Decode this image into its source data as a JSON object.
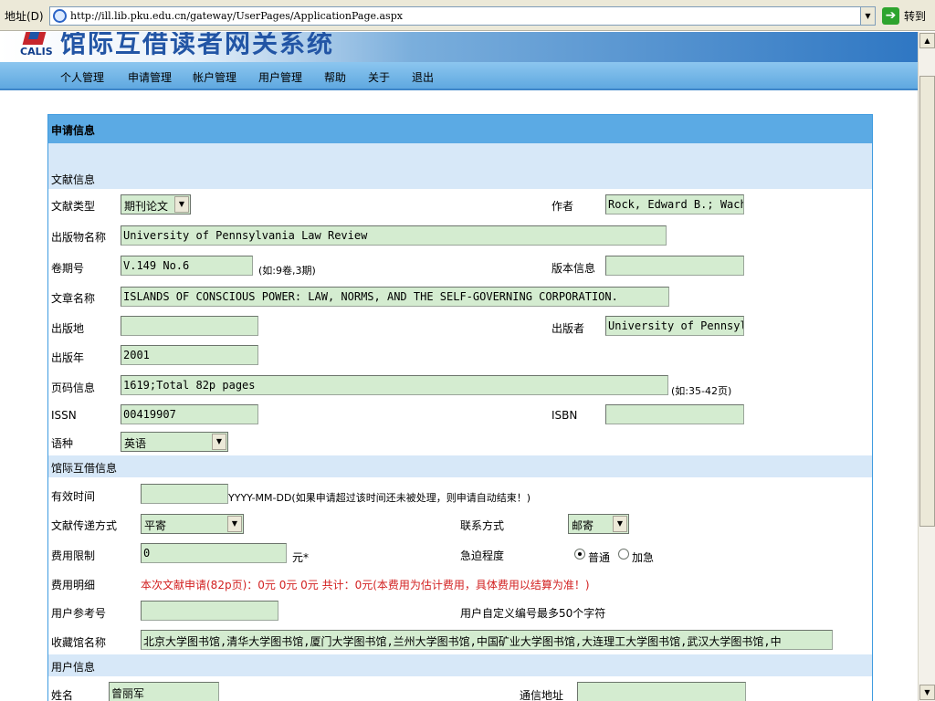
{
  "browser": {
    "address_label": "地址(D)",
    "url": "http://ill.lib.pku.edu.cn/gateway/UserPages/ApplicationPage.aspx",
    "go_label": "转到"
  },
  "banner": {
    "logo_text": "CALIS",
    "title": "馆际互借读者网关系统"
  },
  "nav": [
    "个人管理",
    "申请管理",
    "帐户管理",
    "用户管理",
    "帮助",
    "关于",
    "退出"
  ],
  "panel": {
    "title": "申请信息",
    "doc_section": "文献信息",
    "doc": {
      "type_label": "文献类型",
      "type_value": "期刊论文",
      "author_label": "作者",
      "author_value": "Rock, Edward B.; Wach",
      "pubname_label": "出版物名称",
      "pubname_value": "University of Pennsylvania Law Review",
      "volume_label": "卷期号",
      "volume_value": "V.149 No.6",
      "volume_hint": "(如:9卷,3期)",
      "edition_label": "版本信息",
      "edition_value": "",
      "article_label": "文章名称",
      "article_value": "ISLANDS OF CONSCIOUS POWER: LAW, NORMS, AND THE SELF-GOVERNING CORPORATION.",
      "place_label": "出版地",
      "place_value": "",
      "publisher_label": "出版者",
      "publisher_value": "University of Pennsyl",
      "year_label": "出版年",
      "year_value": "2001",
      "pages_label": "页码信息",
      "pages_value": "1619;Total 82p pages",
      "pages_hint": "(如:35-42页)",
      "issn_label": "ISSN",
      "issn_value": "00419907",
      "isbn_label": "ISBN",
      "isbn_value": "",
      "lang_label": "语种",
      "lang_value": "英语"
    },
    "ill_section": "馆际互借信息",
    "ill": {
      "valid_label": "有效时间",
      "valid_value": "",
      "valid_hint": "YYYY-MM-DD(如果申请超过该时间还未被处理，则申请自动结束！)",
      "delivery_label": "文献传递方式",
      "delivery_value": "平寄",
      "contact_label": "联系方式",
      "contact_value": "邮寄",
      "fee_limit_label": "费用限制",
      "fee_limit_value": "0",
      "fee_unit": "元*",
      "urgency_label": "急迫程度",
      "urgency_normal": "普通",
      "urgency_urgent": "加急",
      "fee_detail_label": "费用明细",
      "fee_detail_value": "本次文献申请(82p页)：0元  0元  0元  共计：0元(本费用为估计费用，具体费用以结算为准！)",
      "ref_label": "用户参考号",
      "ref_value": "",
      "ref_hint": "用户自定义编号最多50个字符",
      "holding_label": "收藏馆名称",
      "holding_value": "北京大学图书馆,清华大学图书馆,厦门大学图书馆,兰州大学图书馆,中国矿业大学图书馆,大连理工大学图书馆,武汉大学图书馆,中"
    },
    "user_section": "用户信息",
    "user": {
      "name_label": "姓名",
      "name_value": "曾丽军",
      "address_label": "通信地址",
      "address_value": ""
    }
  }
}
